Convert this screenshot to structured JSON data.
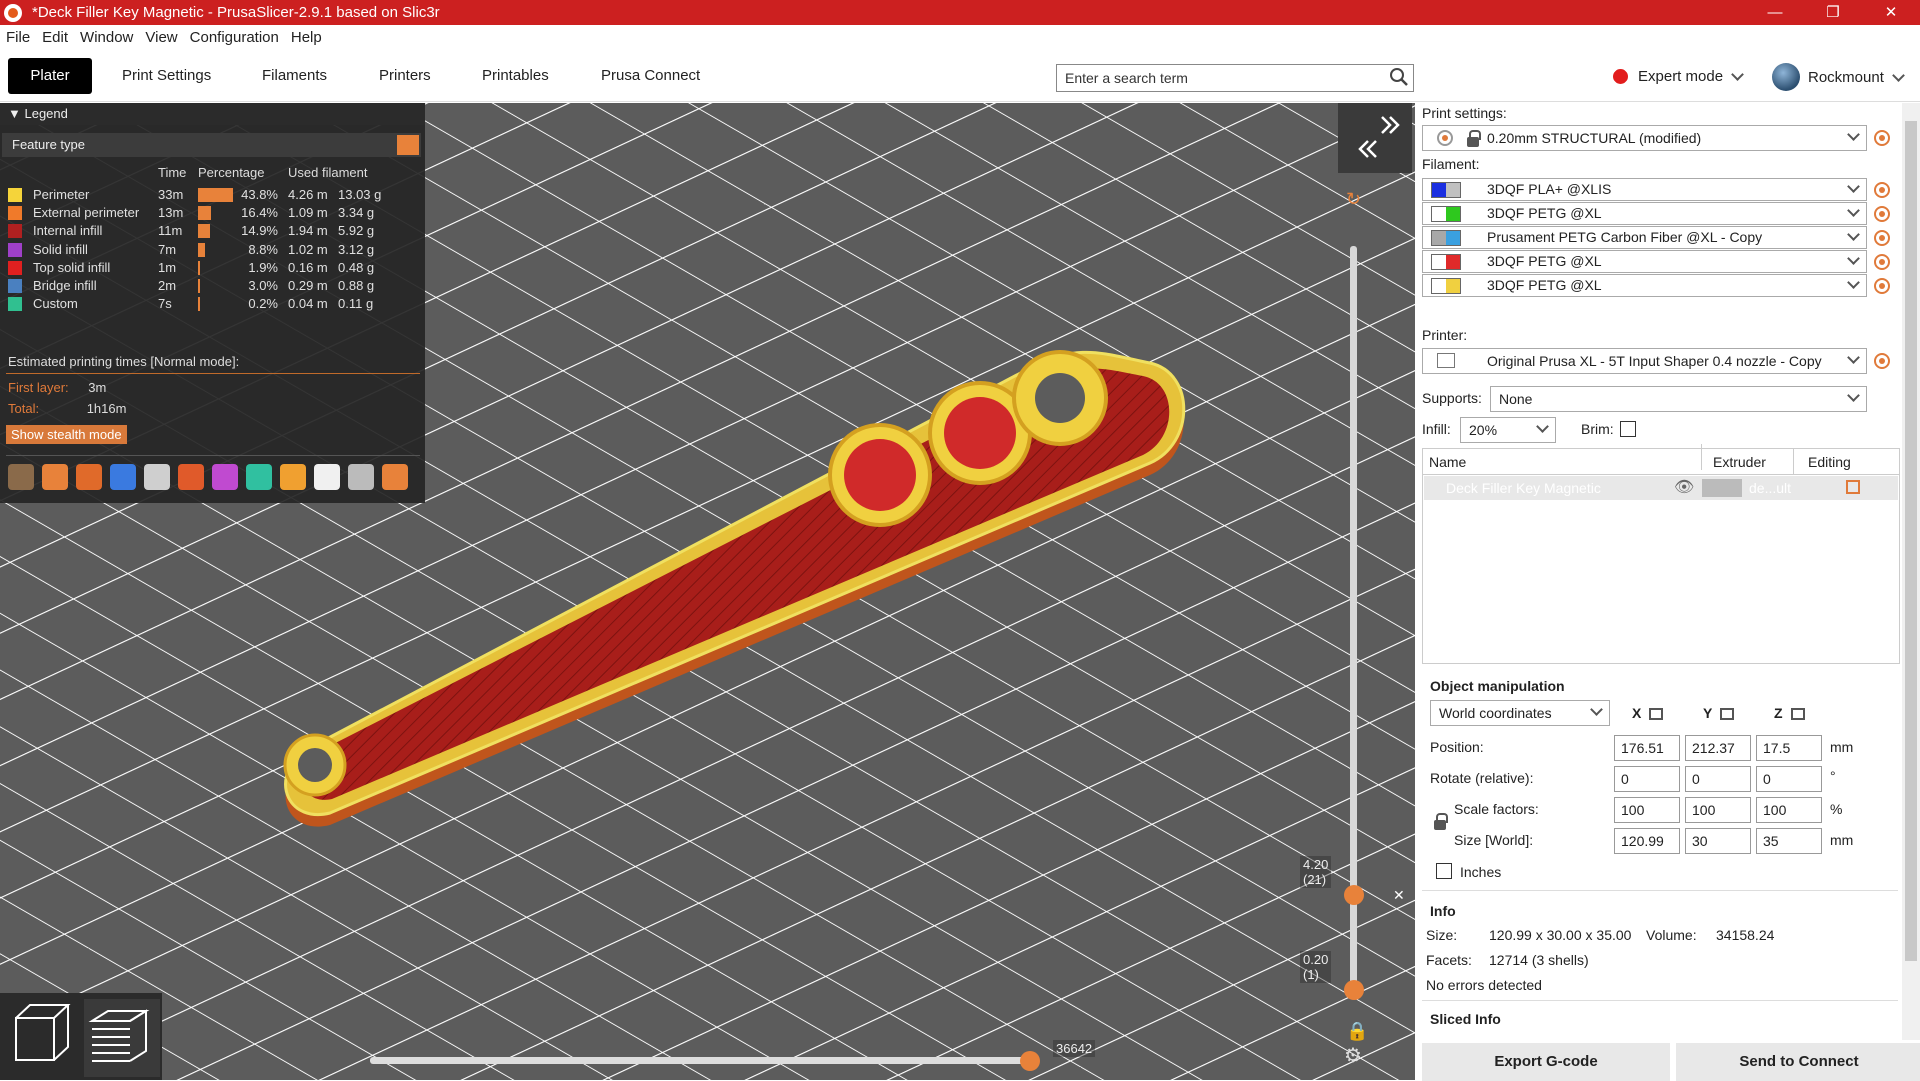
{
  "window": {
    "title": "*Deck Filler Key Magnetic - PrusaSlicer-2.9.1 based on Slic3r",
    "controls": [
      "—",
      "❐",
      "✕"
    ]
  },
  "menu": [
    "File",
    "Edit",
    "Window",
    "View",
    "Configuration",
    "Help"
  ],
  "tabs": [
    "Plater",
    "Print Settings",
    "Filaments",
    "Printers",
    "Printables",
    "Prusa Connect"
  ],
  "search": {
    "placeholder": "Enter a search term"
  },
  "mode": {
    "label": "Expert mode",
    "color": "#e21d1d"
  },
  "user": {
    "name": "Rockmount"
  },
  "legend": {
    "title": "Legend",
    "feature_type": "Feature type",
    "headers": {
      "time": "Time",
      "percentage": "Percentage",
      "used": "Used filament"
    },
    "rows": [
      {
        "name": "Perimeter",
        "time": "33m",
        "pct": "43.8%",
        "frac": 0.438,
        "len": "4.26 m",
        "weight": "13.03 g",
        "color": "#f5d43a"
      },
      {
        "name": "External perimeter",
        "time": "13m",
        "pct": "16.4%",
        "frac": 0.164,
        "len": "1.09 m",
        "weight": "3.34 g",
        "color": "#f07a2a"
      },
      {
        "name": "Internal infill",
        "time": "11m",
        "pct": "14.9%",
        "frac": 0.149,
        "len": "1.94 m",
        "weight": "5.92 g",
        "color": "#b02020"
      },
      {
        "name": "Solid infill",
        "time": "7m",
        "pct": "8.8%",
        "frac": 0.088,
        "len": "1.02 m",
        "weight": "3.12 g",
        "color": "#a040c8"
      },
      {
        "name": "Top solid infill",
        "time": "1m",
        "pct": "1.9%",
        "frac": 0.019,
        "len": "0.16 m",
        "weight": "0.48 g",
        "color": "#e02020"
      },
      {
        "name": "Bridge infill",
        "time": "2m",
        "pct": "3.0%",
        "frac": 0.03,
        "len": "0.29 m",
        "weight": "0.88 g",
        "color": "#4a80c0"
      },
      {
        "name": "Custom",
        "time": "7s",
        "pct": "0.2%",
        "frac": 0.002,
        "len": "0.04 m",
        "weight": "0.11 g",
        "color": "#30c090"
      }
    ],
    "estimated": "Estimated printing times [Normal mode]:",
    "first_layer_label": "First layer:",
    "first_layer_value": "3m",
    "total_label": "Total:",
    "total_value": "1h16m",
    "stealth_button": "Show stealth mode"
  },
  "sliders": {
    "top_layer_height": "4.20",
    "top_layer_index": "(21)",
    "bottom_layer_height": "0.20",
    "bottom_layer_index": "(1)",
    "horizontal_value": "36642"
  },
  "sidebar": {
    "print_settings_label": "Print settings:",
    "print_preset": "0.20mm STRUCTURAL (modified)",
    "filament_label": "Filament:",
    "filaments": [
      {
        "name": "3DQF PLA+ @XLIS",
        "colors": [
          "#1a2ee0",
          "#c0c0c0"
        ]
      },
      {
        "name": "3DQF PETG @XL",
        "colors": [
          "#ffffff",
          "#2ec81e"
        ]
      },
      {
        "name": "Prusament PETG Carbon Fiber @XL - Copy",
        "colors": [
          "#a8a8a8",
          "#3aa0e0"
        ]
      },
      {
        "name": "3DQF PETG @XL",
        "colors": [
          "#ffffff",
          "#e02a2a"
        ]
      },
      {
        "name": "3DQF PETG @XL",
        "colors": [
          "#ffffff",
          "#f0d040"
        ]
      }
    ],
    "printer_label": "Printer:",
    "printer": "Original Prusa XL - 5T Input Shaper 0.4 nozzle - Copy",
    "supports_label": "Supports:",
    "supports_value": "None",
    "infill_label": "Infill:",
    "infill_value": "20%",
    "brim_label": "Brim:",
    "list_headers": {
      "name": "Name",
      "extruder": "Extruder",
      "editing": "Editing"
    },
    "object": {
      "name": "Deck Filler Key Magnetic",
      "extruder": "de...ult"
    },
    "object_manipulation": "Object manipulation",
    "coords": "World coordinates",
    "axes": [
      "X",
      "Y",
      "Z"
    ],
    "position_label": "Position:",
    "position": [
      "176.51",
      "212.37",
      "17.5"
    ],
    "rotate_label": "Rotate (relative):",
    "rotate": [
      "0",
      "0",
      "0"
    ],
    "scale_label": "Scale factors:",
    "scale": [
      "100",
      "100",
      "100"
    ],
    "size_label": "Size [World]:",
    "size": [
      "120.99",
      "30",
      "35"
    ],
    "units": {
      "mm": "mm",
      "deg": "°",
      "pct": "%"
    },
    "inches_label": "Inches",
    "info_title": "Info",
    "info_size_label": "Size:",
    "info_size": "120.99 x 30.00 x 35.00",
    "info_volume_label": "Volume:",
    "info_volume": "34158.24",
    "info_facets_label": "Facets:",
    "info_facets": "12714 (3 shells)",
    "info_errors": "No errors detected",
    "sliced_info": "Sliced Info",
    "export_button": "Export G-code",
    "send_button": "Send to Connect"
  }
}
